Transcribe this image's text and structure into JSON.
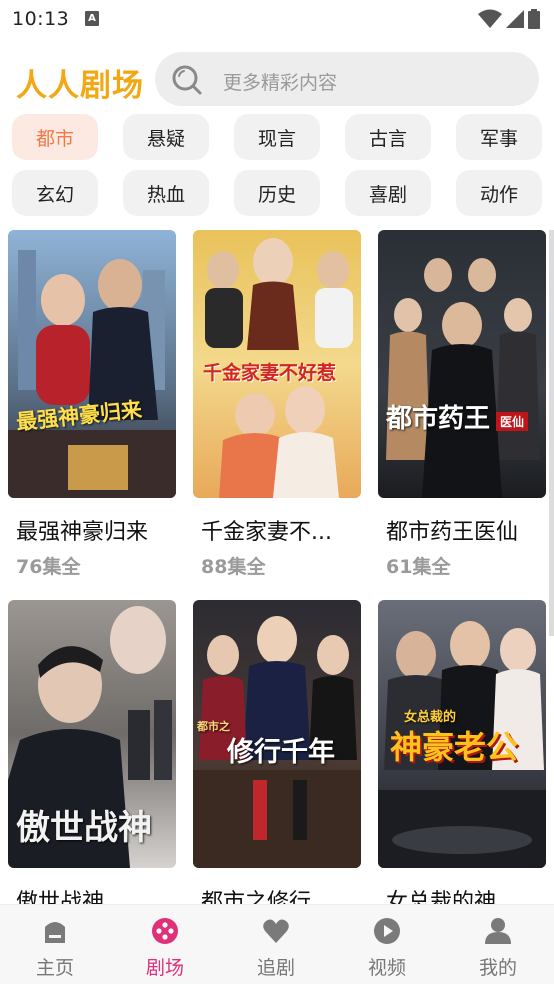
{
  "status_bar": {
    "time": "10:13",
    "notification_letter": "A"
  },
  "header": {
    "app_title": "人人剧场",
    "search_placeholder": "更多精彩内容"
  },
  "categories": [
    {
      "label": "都市",
      "active": true
    },
    {
      "label": "悬疑",
      "active": false
    },
    {
      "label": "现言",
      "active": false
    },
    {
      "label": "古言",
      "active": false
    },
    {
      "label": "军事",
      "active": false
    },
    {
      "label": "玄幻",
      "active": false
    },
    {
      "label": "热血",
      "active": false
    },
    {
      "label": "历史",
      "active": false
    },
    {
      "label": "喜剧",
      "active": false
    },
    {
      "label": "动作",
      "active": false
    }
  ],
  "dramas": [
    {
      "title": "最强神豪归来",
      "episodes": "76集全",
      "poster_text": "最强神豪归来"
    },
    {
      "title": "千金家妻不...",
      "episodes": "88集全",
      "poster_text": "千金家妻不好惹"
    },
    {
      "title": "都市药王医仙",
      "episodes": "61集全",
      "poster_text": "都市药王",
      "poster_badge": "医仙"
    },
    {
      "title": "傲世战神",
      "episodes": "",
      "poster_text": "傲世战神"
    },
    {
      "title": "都市之修行",
      "episodes": "",
      "poster_text": "修行千年",
      "poster_prefix": "都市之"
    },
    {
      "title": "女总裁的神",
      "episodes": "",
      "poster_text": "神豪老公",
      "poster_prefix": "女总裁的"
    }
  ],
  "bottom_nav": [
    {
      "label": "主页",
      "icon": "home-icon",
      "active": false
    },
    {
      "label": "剧场",
      "icon": "theater-icon",
      "active": true
    },
    {
      "label": "追剧",
      "icon": "heart-icon",
      "active": false
    },
    {
      "label": "视频",
      "icon": "play-icon",
      "active": false
    },
    {
      "label": "我的",
      "icon": "profile-icon",
      "active": false
    }
  ],
  "colors": {
    "brand": "#F2A814",
    "active_nav": "#E0307A",
    "active_chip_text": "#F07A4A",
    "active_chip_bg": "#FCE9E1"
  }
}
